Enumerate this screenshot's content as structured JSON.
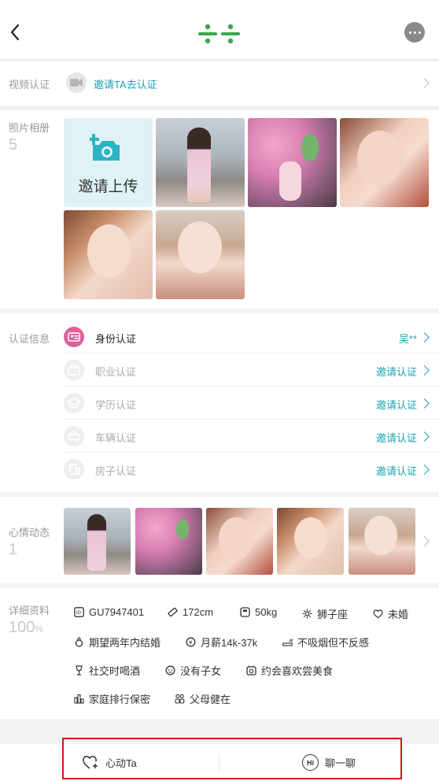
{
  "header": {
    "back_icon": "chevron-left-icon",
    "logo_icon": "app-logo-icon",
    "more_icon": "more-dots-icon",
    "accent_color": "#3aa84a"
  },
  "video": {
    "label": "视频认证",
    "link": "邀请TA去认证"
  },
  "album": {
    "label": "照片相册",
    "count": "5",
    "invite_label": "邀请上传"
  },
  "certs": {
    "label": "认证信息",
    "items": [
      {
        "label": "身份认证",
        "value": "吴**",
        "icon": "id-card-icon"
      },
      {
        "label": "职业认证",
        "value": "邀请认证",
        "icon": "briefcase-icon"
      },
      {
        "label": "学历认证",
        "value": "邀请认证",
        "icon": "graduation-cap-icon"
      },
      {
        "label": "车辆认证",
        "value": "邀请认证",
        "icon": "car-icon"
      },
      {
        "label": "房子认证",
        "value": "邀请认证",
        "icon": "building-icon"
      }
    ]
  },
  "mood": {
    "label": "心情动态",
    "count": "1"
  },
  "details": {
    "label": "详细资料",
    "percent": "100",
    "percent_unit": "%",
    "tags": [
      {
        "text": "GU7947401",
        "icon": "id-icon"
      },
      {
        "text": "172cm",
        "icon": "ruler-icon"
      },
      {
        "text": "50kg",
        "icon": "scale-icon"
      },
      {
        "text": "狮子座",
        "icon": "zodiac-icon"
      },
      {
        "text": "未婚",
        "icon": "heart-icon"
      },
      {
        "text": "期望两年内结婚",
        "icon": "ring-icon"
      },
      {
        "text": "月薪14k-37k",
        "icon": "money-icon"
      },
      {
        "text": "不吸烟但不反感",
        "icon": "cigarette-icon"
      },
      {
        "text": "社交时喝酒",
        "icon": "wine-glass-icon"
      },
      {
        "text": "没有子女",
        "icon": "baby-icon"
      },
      {
        "text": "约会喜欢尝美食",
        "icon": "food-icon"
      },
      {
        "text": "家庭排行保密",
        "icon": "family-rank-icon"
      },
      {
        "text": "父母健在",
        "icon": "parents-icon"
      }
    ]
  },
  "footer": {
    "like_label": "心动Ta",
    "chat_label": "聊一聊",
    "chat_icon_text": "Hi"
  }
}
